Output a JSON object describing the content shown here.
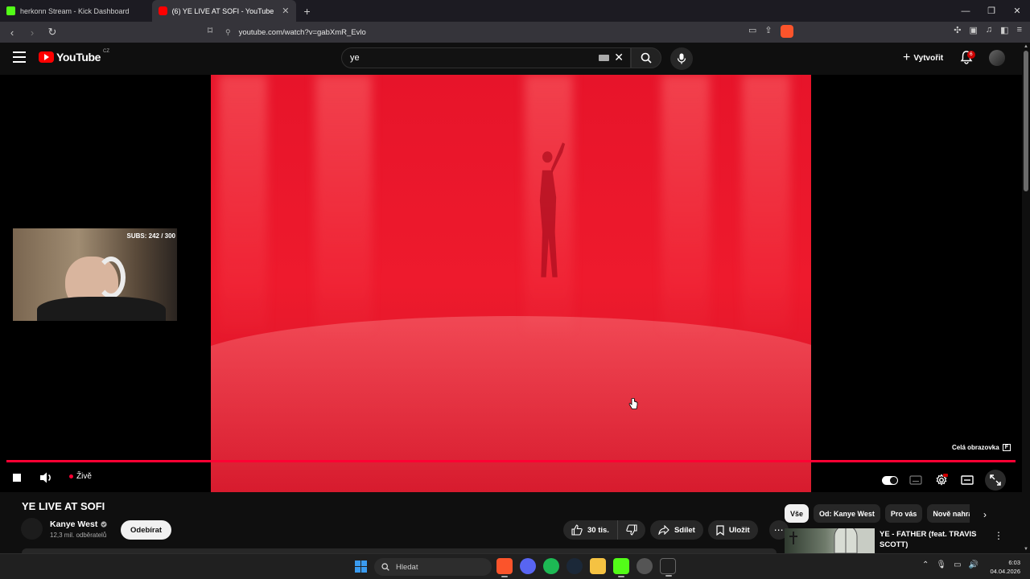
{
  "browser": {
    "tabs": [
      {
        "label": "herkonn Stream - Kick Dashboard",
        "active": false
      },
      {
        "label": "(6) YE LIVE AT SOFI - YouTube",
        "active": true
      }
    ],
    "url": "youtube.com/watch?v=gabXmR_Evlo"
  },
  "youtube": {
    "logo_text": "YouTube",
    "region": "CZ",
    "search_value": "ye",
    "create_label": "Vytvořit",
    "notifications_count": "6"
  },
  "player": {
    "webcam_overlay": "SUBS: 242 / 300",
    "fullscreen_tooltip": "Celá obrazovka",
    "fullscreen_key": "F",
    "live_label": "Živě",
    "progress_fraction": 1.0,
    "accent_color": "#ff0033"
  },
  "video": {
    "title": "YE LIVE AT SOFI",
    "channel": "Kanye West",
    "subscribers": "12,3 mil. odběratelů",
    "subscribe_label": "Odebírat",
    "likes": "30 tis.",
    "share_label": "Sdílet",
    "save_label": "Uložit"
  },
  "sidebar": {
    "chips": [
      {
        "label": "Vše",
        "active": true
      },
      {
        "label": "Od: Kanye West",
        "active": false
      },
      {
        "label": "Pro vás",
        "active": false
      },
      {
        "label": "Nově nahrá",
        "active": false
      }
    ],
    "recommendation": {
      "title": "YE - FATHER (feat. TRAVIS SCOTT)"
    }
  },
  "taskbar": {
    "search_placeholder": "Hledat",
    "time": "6:03",
    "date": "04.04.2026"
  }
}
